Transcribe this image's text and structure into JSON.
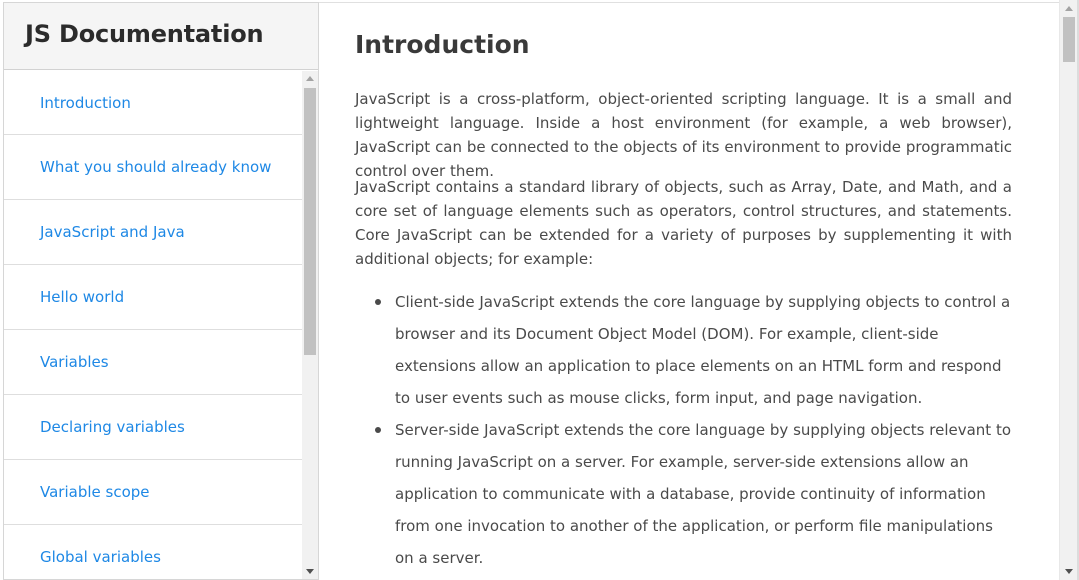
{
  "sidebar": {
    "title": "JS Documentation",
    "items": [
      {
        "label": "Introduction"
      },
      {
        "label": "What you should already know"
      },
      {
        "label": "JavaScript and Java"
      },
      {
        "label": "Hello world"
      },
      {
        "label": "Variables"
      },
      {
        "label": "Declaring variables"
      },
      {
        "label": "Variable scope"
      },
      {
        "label": "Global variables"
      }
    ]
  },
  "main": {
    "heading": "Introduction",
    "paragraphs": [
      "JavaScript is a cross-platform, object-oriented scripting language. It is a small and lightweight language. Inside a host environment (for example, a web browser), JavaScript can be connected to the objects of its environment to provide programmatic control over them.",
      "JavaScript contains a standard library of objects, such as Array, Date, and Math, and a core set of language elements such as operators, control structures, and statements. Core JavaScript can be extended for a variety of purposes by supplementing it with additional objects; for example:"
    ],
    "bullets": [
      "Client-side JavaScript extends the core language by supplying objects to control a browser and its Document Object Model (DOM). For example, client-side extensions allow an application to place elements on an HTML form and respond to user events such as mouse clicks, form input, and page navigation.",
      "Server-side JavaScript extends the core language by supplying objects relevant to running JavaScript on a server. For example, server-side extensions allow an application to communicate with a database, provide continuity of information from one invocation to another of the application, or perform file manipulations on a server."
    ]
  },
  "colors": {
    "link": "#1e88e5",
    "header_bg": "#f5f5f5",
    "text": "#4a4a4a"
  }
}
